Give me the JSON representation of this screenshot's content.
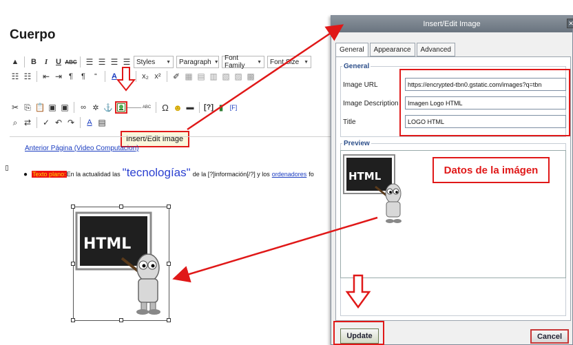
{
  "editor": {
    "title": "Cuerpo",
    "styles_select": "Styles",
    "paragraph_select": "Paragraph",
    "font_family_select": "Font Family",
    "font_size_select": "Font Size",
    "tooltip": "Insert/Edit Image",
    "prev_link": "Anterior Página (Video Computacion)",
    "bullet": {
      "highlighted": "Texto plano:",
      "text1": "En la actualidad las",
      "big_word": "\"tecnologías\"",
      "text2": "de la [?]información[/?] y los",
      "link": "ordenadores",
      "text3": "fo"
    },
    "image_text": "HTML"
  },
  "dialog": {
    "title": "Insert/Edit Image",
    "tabs": [
      "General",
      "Appearance",
      "Advanced"
    ],
    "general_legend": "General",
    "fields": [
      {
        "label": "Image URL",
        "value": "https://encrypted-tbn0.gstatic.com/images?q=tbn"
      },
      {
        "label": "Image Description",
        "value": "Imagen Logo HTML"
      },
      {
        "label": "Title",
        "value": "LOGO HTML"
      }
    ],
    "preview_legend": "Preview",
    "preview_image_text": "HTML",
    "annotation": "Datos de la imágen",
    "update_label": "Update",
    "cancel_label": "Cancel"
  },
  "colors": {
    "annotation_red": "#e01818",
    "dialog_title_bg": "#6a747f",
    "link_blue": "#1a3cc0"
  }
}
